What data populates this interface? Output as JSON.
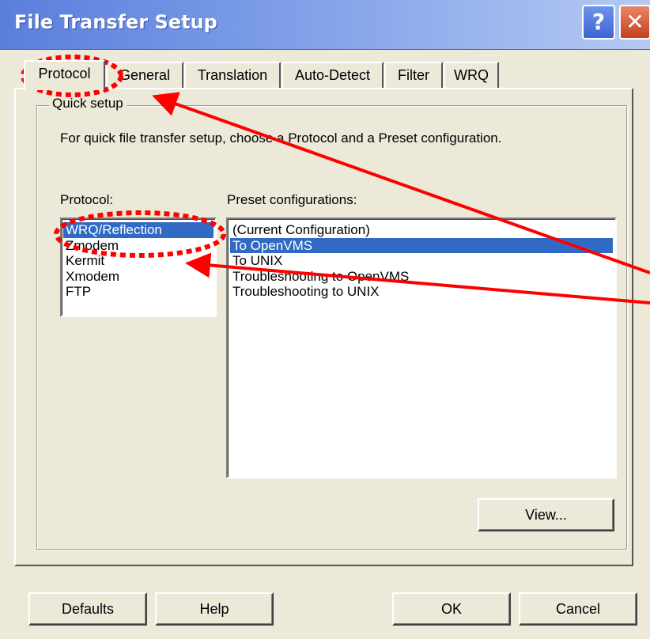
{
  "window": {
    "title": "File Transfer Setup"
  },
  "title_buttons": {
    "help": "?",
    "close": "✕"
  },
  "tabs": [
    {
      "label": "Protocol",
      "active": true
    },
    {
      "label": "General"
    },
    {
      "label": "Translation"
    },
    {
      "label": "Auto-Detect"
    },
    {
      "label": "Filter"
    },
    {
      "label": "WRQ"
    }
  ],
  "quick_setup": {
    "group_label": "Quick setup",
    "description": "For quick file transfer setup, choose a Protocol and a Preset configuration.",
    "protocol_label": "Protocol:",
    "preset_label": "Preset configurations:",
    "protocols": [
      "WRQ/Reflection",
      "Zmodem",
      "Kermit",
      "Xmodem",
      "FTP"
    ],
    "selected_protocol": "WRQ/Reflection",
    "presets": [
      "(Current Configuration)",
      "To OpenVMS",
      "To UNIX",
      "Troubleshooting to OpenVMS",
      "Troubleshooting to UNIX"
    ],
    "selected_preset": "To OpenVMS",
    "view_label": "View..."
  },
  "buttons": {
    "defaults": "Defaults",
    "help": "Help",
    "ok": "OK",
    "cancel": "Cancel"
  },
  "colors": {
    "selection": "#316ac5",
    "annotation": "#ff0000",
    "titlebar": "#5a7edc"
  }
}
